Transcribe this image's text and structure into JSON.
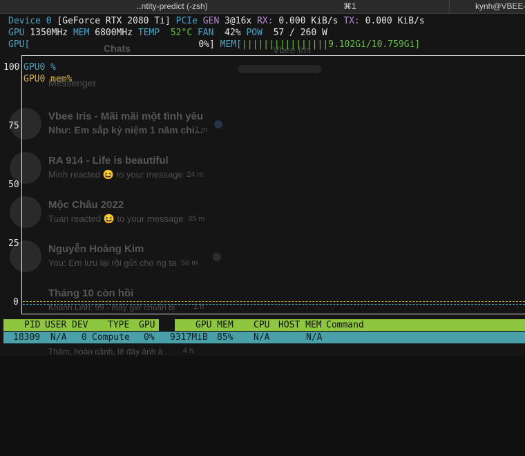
{
  "window": {
    "tab_title": "..ntity-predict (-zsh)",
    "tab_shortcut": "⌘1",
    "user_host": "kynh@VBEE-V"
  },
  "device": {
    "label": "Device 0",
    "name": "[GeForce RTX 2080 Ti]",
    "pcie_label": "PCIe",
    "gen_label": "GEN",
    "gen_value": "3@16x",
    "rx_label": "RX:",
    "rx_value": "0.000 KiB/s",
    "tx_label": "TX:",
    "tx_value": "0.000 KiB/s"
  },
  "clocks": {
    "gpu_label": "GPU",
    "gpu_value": "1350MHz",
    "mem_label": "MEM",
    "mem_value": "6800MHz",
    "temp_label": "TEMP",
    "temp_value": "52°C",
    "fan_label": "FAN",
    "fan_value": "42%",
    "pow_label": "POW",
    "pow_value": "57 / 260 W"
  },
  "usage": {
    "gpu_label": "GPU[",
    "gpu_value": "0%]",
    "mem_label": "MEM[",
    "mem_bars": "||||||||||||||||",
    "mem_value": "9.102Gi/10.759Gi]"
  },
  "plot": {
    "y_ticks": [
      "100",
      "75",
      "50",
      "25",
      "0"
    ],
    "legend": [
      {
        "label": "GPU0 %",
        "color": "#4aa3c8"
      },
      {
        "label": "GPU0 mem%",
        "color": "#d7b14a"
      }
    ]
  },
  "process_table": {
    "headers": [
      "PID",
      "USER",
      "DEV",
      "TYPE",
      "GPU",
      "GPU MEM",
      "CPU",
      "HOST MEM",
      "Command"
    ],
    "rows": [
      {
        "pid": "18309",
        "user": "N/A",
        "dev": "0",
        "type": "Compute",
        "gpu": "0%",
        "gpu_mem": "9317MiB",
        "gpu_mem_pct": "85%",
        "cpu": "N/A",
        "host_mem": "N/A",
        "command": ""
      }
    ]
  },
  "background_ghost": {
    "chats_title": "Chats",
    "search_placeholder": "Messenger",
    "right_header": "Vbee Iris",
    "chats": [
      {
        "name": "Vbee Iris - Mãi mãi một tình yêu",
        "preview": "Như: Em sắp kỷ niệm 1 năm chi...",
        "time": "1 m"
      },
      {
        "name": "RA 914 - Life is beautiful",
        "preview": "Minh reacted 😆 to your message",
        "time": "24 m"
      },
      {
        "name": "Mộc Châu 2022",
        "preview": "Tuan reacted 😆 to your message",
        "time": "35 m"
      },
      {
        "name": "Nguyễn Hoàng Kim",
        "preview": "You: Em lưu lại rồi gửi cho ng ta",
        "time": "56 m"
      },
      {
        "name": "Tháng 10 còn hồi",
        "preview": "Khánh Linh: 99 - mấy giờ chuẩn bị",
        "time": "1 h"
      },
      {
        "name": "",
        "preview": "Thâm, hoàn cảnh, lẽ đây ảnh à",
        "time": "4 h"
      }
    ]
  }
}
